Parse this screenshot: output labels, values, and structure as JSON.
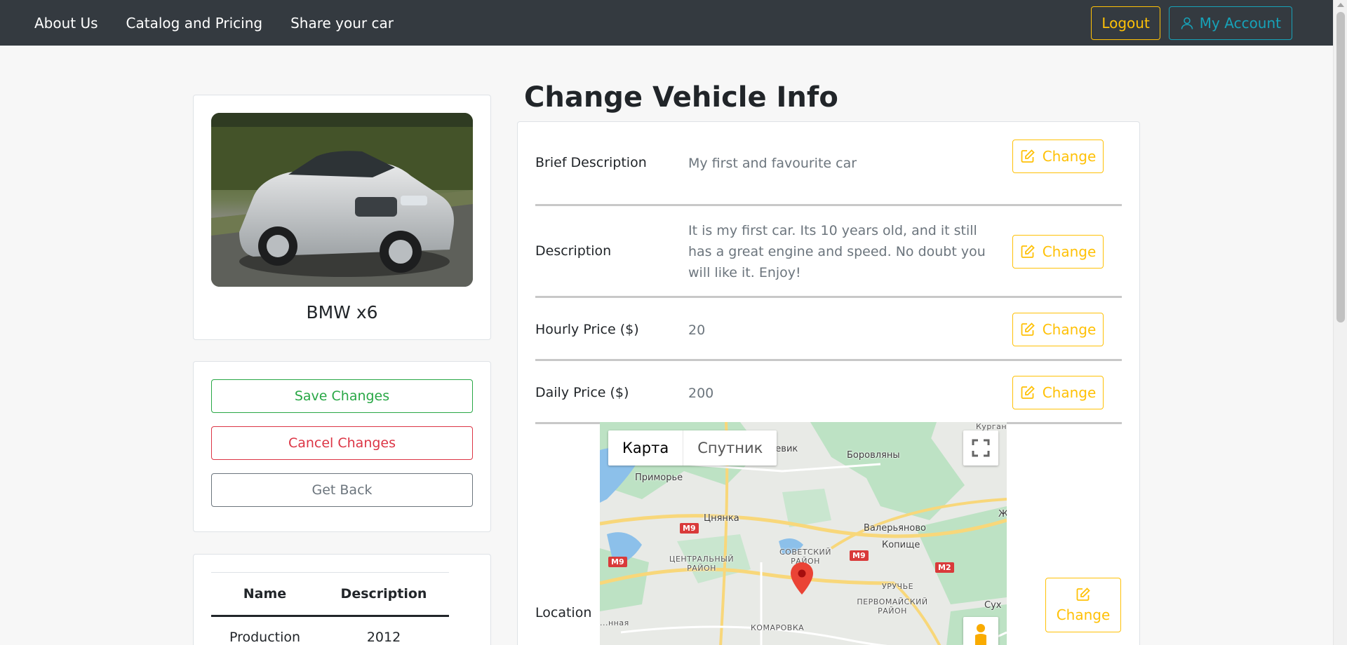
{
  "nav": {
    "links": [
      "About Us",
      "Catalog and Pricing",
      "Share your car"
    ],
    "logout_label": "Logout",
    "account_label": "My Account"
  },
  "car": {
    "title": "BMW x6"
  },
  "actions": {
    "save_label": "Save Changes",
    "cancel_label": "Cancel Changes",
    "back_label": "Get Back"
  },
  "specs": {
    "headers": [
      "Name",
      "Description"
    ],
    "rows": [
      {
        "name": "Production",
        "description": "2012"
      }
    ]
  },
  "page_title": "Change Vehicle Info",
  "change_label": "Change",
  "fields": [
    {
      "label": "Brief Description",
      "value": "My first and favourite car"
    },
    {
      "label": "Description",
      "value": "It is my first car. Its 10 years old, and it still has a great engine and speed. No doubt you will like it. Enjoy!"
    },
    {
      "label": "Hourly Price ($)",
      "value": "20"
    },
    {
      "label": "Daily Price ($)",
      "value": "200"
    }
  ],
  "location": {
    "label": "Location",
    "map_types": [
      "Карта",
      "Спутник"
    ],
    "places": [
      "Приморье",
      "Цнянка",
      "Боровляны",
      "Валерьяново",
      "Копище",
      "УРУЧЬЕ",
      "ПЕРВОМАЙСКИЙ РАЙОН",
      "КОМАРОВКА",
      "ЦЕНТРАЛЬНЫЙ РАЙОН",
      "СОВЕТСКИЙ РАЙОН",
      "Курган",
      "...шевик",
      "Сух",
      "Ж",
      "...нная"
    ],
    "roads": [
      "M9",
      "M9",
      "M9",
      "M2"
    ]
  },
  "colors": {
    "navbar": "#343a40",
    "warning": "#ffc107",
    "info": "#17a2b8",
    "success": "#28a745",
    "danger": "#dc3545",
    "secondary": "#6c757d"
  }
}
